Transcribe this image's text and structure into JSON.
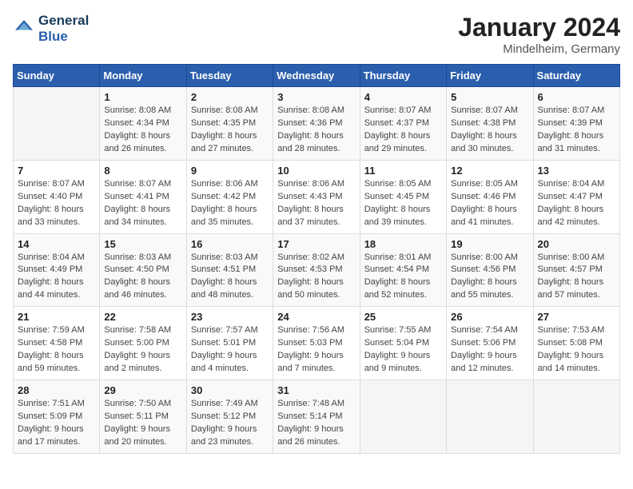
{
  "header": {
    "logo_line1": "General",
    "logo_line2": "Blue",
    "title": "January 2024",
    "subtitle": "Mindelheim, Germany"
  },
  "columns": [
    "Sunday",
    "Monday",
    "Tuesday",
    "Wednesday",
    "Thursday",
    "Friday",
    "Saturday"
  ],
  "weeks": [
    [
      {
        "day": "",
        "sunrise": "",
        "sunset": "",
        "daylight": ""
      },
      {
        "day": "1",
        "sunrise": "Sunrise: 8:08 AM",
        "sunset": "Sunset: 4:34 PM",
        "daylight": "Daylight: 8 hours and 26 minutes."
      },
      {
        "day": "2",
        "sunrise": "Sunrise: 8:08 AM",
        "sunset": "Sunset: 4:35 PM",
        "daylight": "Daylight: 8 hours and 27 minutes."
      },
      {
        "day": "3",
        "sunrise": "Sunrise: 8:08 AM",
        "sunset": "Sunset: 4:36 PM",
        "daylight": "Daylight: 8 hours and 28 minutes."
      },
      {
        "day": "4",
        "sunrise": "Sunrise: 8:07 AM",
        "sunset": "Sunset: 4:37 PM",
        "daylight": "Daylight: 8 hours and 29 minutes."
      },
      {
        "day": "5",
        "sunrise": "Sunrise: 8:07 AM",
        "sunset": "Sunset: 4:38 PM",
        "daylight": "Daylight: 8 hours and 30 minutes."
      },
      {
        "day": "6",
        "sunrise": "Sunrise: 8:07 AM",
        "sunset": "Sunset: 4:39 PM",
        "daylight": "Daylight: 8 hours and 31 minutes."
      }
    ],
    [
      {
        "day": "7",
        "sunrise": "Sunrise: 8:07 AM",
        "sunset": "Sunset: 4:40 PM",
        "daylight": "Daylight: 8 hours and 33 minutes."
      },
      {
        "day": "8",
        "sunrise": "Sunrise: 8:07 AM",
        "sunset": "Sunset: 4:41 PM",
        "daylight": "Daylight: 8 hours and 34 minutes."
      },
      {
        "day": "9",
        "sunrise": "Sunrise: 8:06 AM",
        "sunset": "Sunset: 4:42 PM",
        "daylight": "Daylight: 8 hours and 35 minutes."
      },
      {
        "day": "10",
        "sunrise": "Sunrise: 8:06 AM",
        "sunset": "Sunset: 4:43 PM",
        "daylight": "Daylight: 8 hours and 37 minutes."
      },
      {
        "day": "11",
        "sunrise": "Sunrise: 8:05 AM",
        "sunset": "Sunset: 4:45 PM",
        "daylight": "Daylight: 8 hours and 39 minutes."
      },
      {
        "day": "12",
        "sunrise": "Sunrise: 8:05 AM",
        "sunset": "Sunset: 4:46 PM",
        "daylight": "Daylight: 8 hours and 41 minutes."
      },
      {
        "day": "13",
        "sunrise": "Sunrise: 8:04 AM",
        "sunset": "Sunset: 4:47 PM",
        "daylight": "Daylight: 8 hours and 42 minutes."
      }
    ],
    [
      {
        "day": "14",
        "sunrise": "Sunrise: 8:04 AM",
        "sunset": "Sunset: 4:49 PM",
        "daylight": "Daylight: 8 hours and 44 minutes."
      },
      {
        "day": "15",
        "sunrise": "Sunrise: 8:03 AM",
        "sunset": "Sunset: 4:50 PM",
        "daylight": "Daylight: 8 hours and 46 minutes."
      },
      {
        "day": "16",
        "sunrise": "Sunrise: 8:03 AM",
        "sunset": "Sunset: 4:51 PM",
        "daylight": "Daylight: 8 hours and 48 minutes."
      },
      {
        "day": "17",
        "sunrise": "Sunrise: 8:02 AM",
        "sunset": "Sunset: 4:53 PM",
        "daylight": "Daylight: 8 hours and 50 minutes."
      },
      {
        "day": "18",
        "sunrise": "Sunrise: 8:01 AM",
        "sunset": "Sunset: 4:54 PM",
        "daylight": "Daylight: 8 hours and 52 minutes."
      },
      {
        "day": "19",
        "sunrise": "Sunrise: 8:00 AM",
        "sunset": "Sunset: 4:56 PM",
        "daylight": "Daylight: 8 hours and 55 minutes."
      },
      {
        "day": "20",
        "sunrise": "Sunrise: 8:00 AM",
        "sunset": "Sunset: 4:57 PM",
        "daylight": "Daylight: 8 hours and 57 minutes."
      }
    ],
    [
      {
        "day": "21",
        "sunrise": "Sunrise: 7:59 AM",
        "sunset": "Sunset: 4:58 PM",
        "daylight": "Daylight: 8 hours and 59 minutes."
      },
      {
        "day": "22",
        "sunrise": "Sunrise: 7:58 AM",
        "sunset": "Sunset: 5:00 PM",
        "daylight": "Daylight: 9 hours and 2 minutes."
      },
      {
        "day": "23",
        "sunrise": "Sunrise: 7:57 AM",
        "sunset": "Sunset: 5:01 PM",
        "daylight": "Daylight: 9 hours and 4 minutes."
      },
      {
        "day": "24",
        "sunrise": "Sunrise: 7:56 AM",
        "sunset": "Sunset: 5:03 PM",
        "daylight": "Daylight: 9 hours and 7 minutes."
      },
      {
        "day": "25",
        "sunrise": "Sunrise: 7:55 AM",
        "sunset": "Sunset: 5:04 PM",
        "daylight": "Daylight: 9 hours and 9 minutes."
      },
      {
        "day": "26",
        "sunrise": "Sunrise: 7:54 AM",
        "sunset": "Sunset: 5:06 PM",
        "daylight": "Daylight: 9 hours and 12 minutes."
      },
      {
        "day": "27",
        "sunrise": "Sunrise: 7:53 AM",
        "sunset": "Sunset: 5:08 PM",
        "daylight": "Daylight: 9 hours and 14 minutes."
      }
    ],
    [
      {
        "day": "28",
        "sunrise": "Sunrise: 7:51 AM",
        "sunset": "Sunset: 5:09 PM",
        "daylight": "Daylight: 9 hours and 17 minutes."
      },
      {
        "day": "29",
        "sunrise": "Sunrise: 7:50 AM",
        "sunset": "Sunset: 5:11 PM",
        "daylight": "Daylight: 9 hours and 20 minutes."
      },
      {
        "day": "30",
        "sunrise": "Sunrise: 7:49 AM",
        "sunset": "Sunset: 5:12 PM",
        "daylight": "Daylight: 9 hours and 23 minutes."
      },
      {
        "day": "31",
        "sunrise": "Sunrise: 7:48 AM",
        "sunset": "Sunset: 5:14 PM",
        "daylight": "Daylight: 9 hours and 26 minutes."
      },
      {
        "day": "",
        "sunrise": "",
        "sunset": "",
        "daylight": ""
      },
      {
        "day": "",
        "sunrise": "",
        "sunset": "",
        "daylight": ""
      },
      {
        "day": "",
        "sunrise": "",
        "sunset": "",
        "daylight": ""
      }
    ]
  ]
}
